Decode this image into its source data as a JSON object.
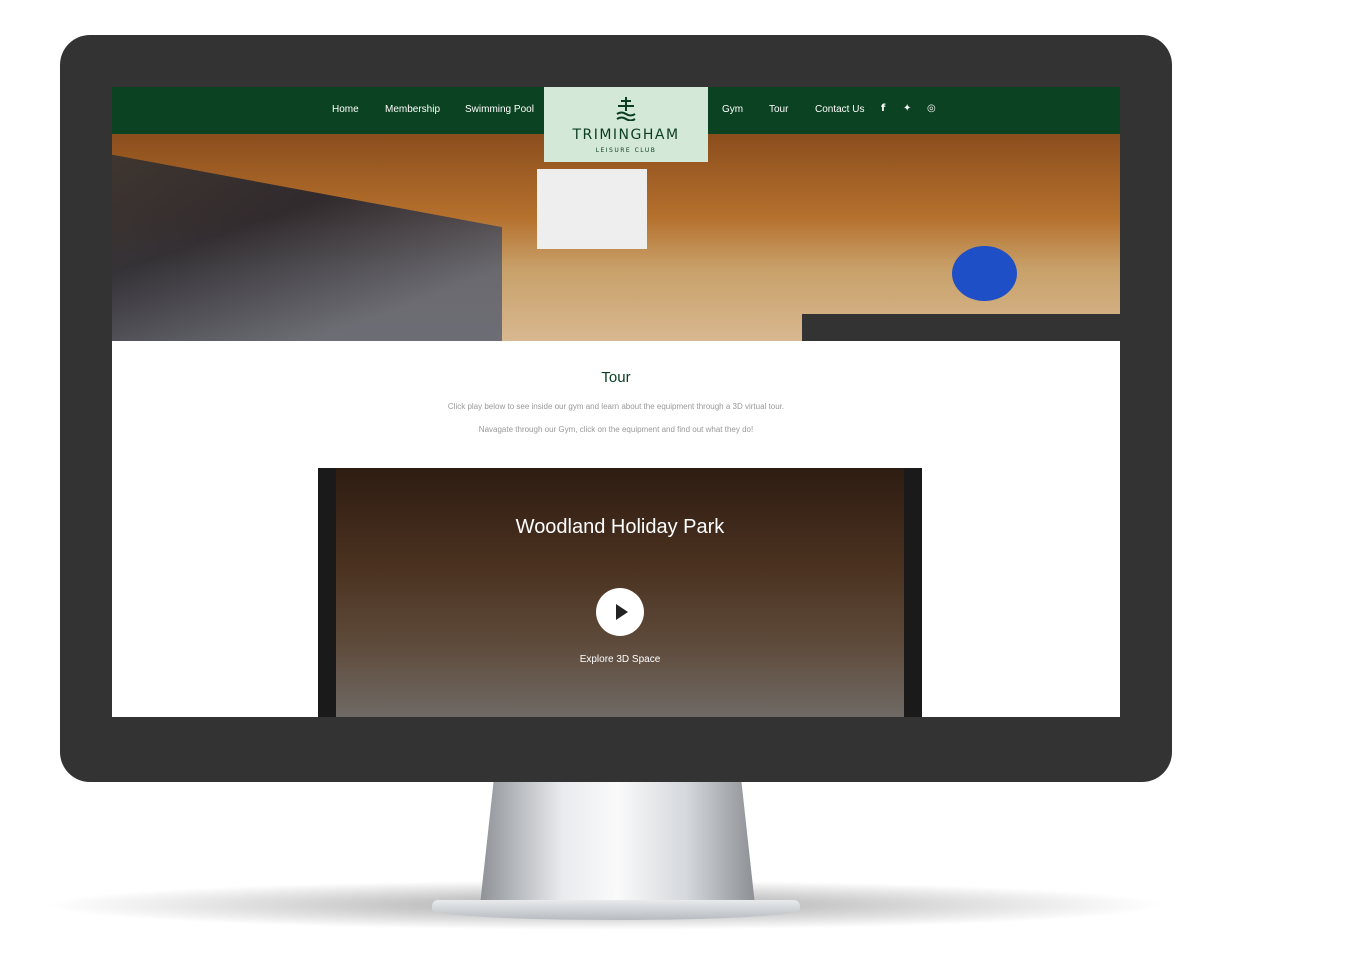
{
  "nav": {
    "left": [
      "Home",
      "Membership",
      "Swimming Pool"
    ],
    "right": [
      "Gym",
      "Tour",
      "Contact Us"
    ],
    "social": [
      "facebook-icon",
      "twitter-icon",
      "instagram-icon"
    ]
  },
  "logo": {
    "title": "TRIMINGHAM",
    "subtitle": "LEISURE CLUB"
  },
  "colors": {
    "nav": "#0b4221",
    "logo_bg": "#d3e8d6"
  },
  "content": {
    "title": "Tour",
    "line1": "Click play below to see inside our gym and learn about the equipment through a 3D virtual tour.",
    "line2": "Navagate through our Gym, click on the equipment and find out what they do!"
  },
  "video": {
    "title": "Woodland Holiday Park",
    "cta": "Explore 3D Space"
  }
}
